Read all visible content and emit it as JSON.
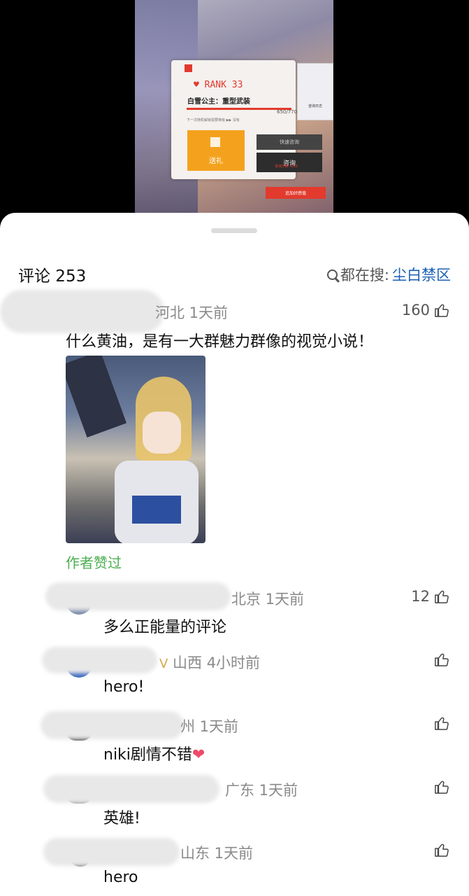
{
  "video": {
    "rank_label": "♥ RANK 33",
    "character_name": "白雪公主：重型武装",
    "progress_count": "650/770",
    "progress_fraction": 0.84,
    "progress_hint": "下一次随机解锁需要等级 ▶▶ 没有",
    "gift_label": "送礼",
    "quick_consult_label": "快速咨询",
    "consult_label": "咨询",
    "consult_sub": "咨询次数 9/10",
    "char_caption": "咨询日志",
    "favor_label": "追加好感值"
  },
  "comments_header": {
    "title": "评论 253",
    "search_prefix": "都在搜:",
    "search_keyword": "尘白禁区"
  },
  "comments": [
    {
      "meta": "河北 1天前",
      "likes": "160",
      "text": "什么黄油，是有一大群魅力群像的视觉小说！",
      "author_liked": "作者赞过"
    },
    {
      "meta": "北京 1天前",
      "likes": "12",
      "text": "多么正能量的评论"
    },
    {
      "badge": "Ⅴ",
      "meta": "山西 4小时前",
      "likes": "",
      "text": "hero!"
    },
    {
      "meta": "州 1天前",
      "likes": "",
      "text": "niki剧情不错",
      "emoji": "❤"
    },
    {
      "meta": "广东 1天前",
      "likes": "",
      "text": "英雄!"
    },
    {
      "meta": "山东 1天前",
      "likes": "",
      "text": "hero"
    }
  ]
}
